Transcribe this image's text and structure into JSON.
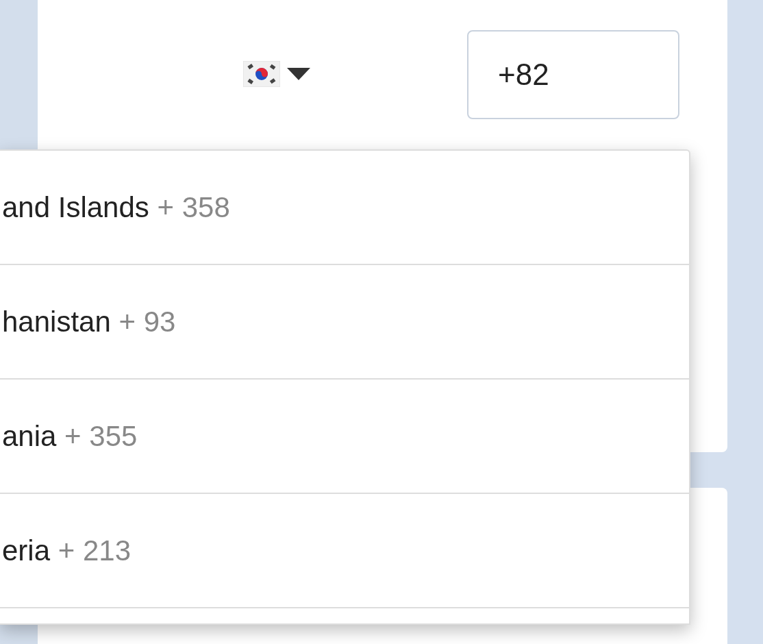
{
  "country_picker": {
    "code_field": {
      "value": "+82"
    }
  },
  "dropdown": {
    "items": [
      {
        "name": "and Islands",
        "code": "+ 358"
      },
      {
        "name": "hanistan",
        "code": "+ 93"
      },
      {
        "name": "ania",
        "code": "+ 355"
      },
      {
        "name": "eria",
        "code": "+ 213"
      }
    ]
  }
}
